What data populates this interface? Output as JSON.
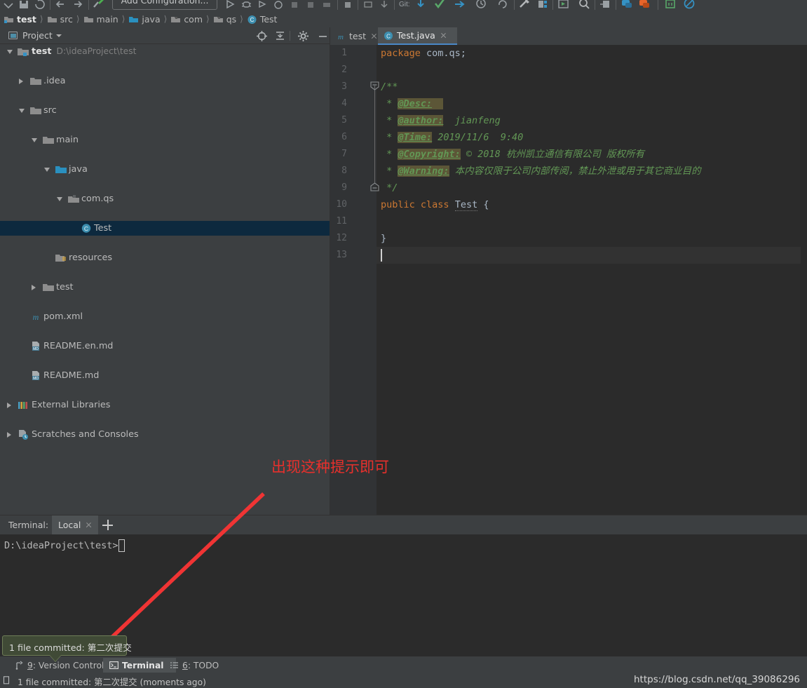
{
  "window": {
    "run_configuration": "Add Configuration..."
  },
  "breadcrumb": [
    {
      "label": "test",
      "icon": "project-module-icon"
    },
    {
      "label": "src",
      "icon": "folder-icon"
    },
    {
      "label": "main",
      "icon": "folder-icon"
    },
    {
      "label": "java",
      "icon": "source-folder-icon"
    },
    {
      "label": "com",
      "icon": "package-icon"
    },
    {
      "label": "qs",
      "icon": "package-icon"
    },
    {
      "label": "Test",
      "icon": "java-class-icon"
    }
  ],
  "project_panel": {
    "title": "Project",
    "buttons": [
      {
        "name": "locate-target-icon",
        "label": "Select Opened File"
      },
      {
        "name": "collapse-all-icon",
        "label": "Collapse All"
      },
      {
        "name": "gear-icon",
        "label": "Settings"
      },
      {
        "name": "minimize-icon",
        "label": "Hide"
      }
    ],
    "tree": [
      {
        "label": "test",
        "path": "D:\\ideaProject\\test",
        "indent": 0,
        "arrow": "open",
        "icon": "module-icon",
        "bold": true,
        "selected": false
      },
      {
        "label": ".idea",
        "path": "",
        "indent": 1,
        "arrow": "closed",
        "icon": "folder-icon",
        "bold": false,
        "selected": false
      },
      {
        "label": "src",
        "path": "",
        "indent": 1,
        "arrow": "open",
        "icon": "folder-icon",
        "bold": false,
        "selected": false
      },
      {
        "label": "main",
        "path": "",
        "indent": 2,
        "arrow": "open",
        "icon": "folder-icon",
        "bold": false,
        "selected": false
      },
      {
        "label": "java",
        "path": "",
        "indent": 3,
        "arrow": "open",
        "icon": "source-folder-icon",
        "bold": false,
        "selected": false
      },
      {
        "label": "com.qs",
        "path": "",
        "indent": 4,
        "arrow": "open",
        "icon": "package-icon",
        "bold": false,
        "selected": false
      },
      {
        "label": "Test",
        "path": "",
        "indent": 5,
        "arrow": "none",
        "icon": "java-class-icon",
        "bold": false,
        "selected": true
      },
      {
        "label": "resources",
        "path": "",
        "indent": 4,
        "arrow": "none",
        "icon": "resources-folder-icon",
        "bold": false,
        "selected": false
      },
      {
        "label": "test",
        "path": "",
        "indent": 2,
        "arrow": "closed",
        "icon": "folder-icon",
        "bold": false,
        "selected": false
      },
      {
        "label": "pom.xml",
        "path": "",
        "indent": 2,
        "arrow": "none",
        "icon": "maven-icon",
        "bold": false,
        "selected": false
      },
      {
        "label": "README.en.md",
        "path": "",
        "indent": 2,
        "arrow": "none",
        "icon": "markdown-icon",
        "bold": false,
        "selected": false
      },
      {
        "label": "README.md",
        "path": "",
        "indent": 2,
        "arrow": "none",
        "icon": "markdown-icon",
        "bold": false,
        "selected": false
      },
      {
        "label": "External Libraries",
        "path": "",
        "indent": 0,
        "arrow": "closed",
        "icon": "libraries-icon",
        "bold": false,
        "selected": false
      },
      {
        "label": "Scratches and Consoles",
        "path": "",
        "indent": 0,
        "arrow": "closed",
        "icon": "scratches-icon",
        "bold": false,
        "selected": false
      }
    ]
  },
  "editor": {
    "tabs": [
      {
        "label": "test",
        "icon": "maven-icon",
        "active": false
      },
      {
        "label": "Test.java",
        "icon": "java-class-icon",
        "active": true
      }
    ],
    "line_numbers": [
      "1",
      "2",
      "3",
      "4",
      "5",
      "6",
      "7",
      "8",
      "9",
      "10",
      "11",
      "12",
      "13"
    ],
    "code_lines": [
      {
        "n": 1,
        "segments": [
          {
            "t": "package",
            "c": "kw"
          },
          {
            "t": " com.qs;",
            "c": "pl"
          }
        ]
      },
      {
        "n": 2,
        "segments": []
      },
      {
        "n": 3,
        "segments": [
          {
            "t": "/**",
            "c": "cm"
          }
        ]
      },
      {
        "n": 4,
        "segments": [
          {
            "t": " * ",
            "c": "cm"
          },
          {
            "t": "@Desc:",
            "c": "tag"
          }
        ]
      },
      {
        "n": 5,
        "segments": [
          {
            "t": " * ",
            "c": "cm"
          },
          {
            "t": "@author:",
            "c": "tag"
          },
          {
            "t": "  jianfeng",
            "c": "cmz"
          }
        ]
      },
      {
        "n": 6,
        "segments": [
          {
            "t": " * ",
            "c": "cm"
          },
          {
            "t": "@Time:",
            "c": "tag"
          },
          {
            "t": " 2019/11/6  9:40",
            "c": "cmz"
          }
        ]
      },
      {
        "n": 7,
        "segments": [
          {
            "t": " * ",
            "c": "cm"
          },
          {
            "t": "@Copyright:",
            "c": "tag"
          },
          {
            "t": " © 2018 杭州凯立通信有限公司 版权所有",
            "c": "cmz"
          }
        ]
      },
      {
        "n": 8,
        "segments": [
          {
            "t": " * ",
            "c": "cm"
          },
          {
            "t": "@Warning:",
            "c": "tag"
          },
          {
            "t": " 本内容仅限于公司内部传阅，禁止外泄或用于其它商业目的",
            "c": "cmz"
          }
        ]
      },
      {
        "n": 9,
        "segments": [
          {
            "t": " */",
            "c": "cm"
          }
        ]
      },
      {
        "n": 10,
        "segments": [
          {
            "t": "public",
            "c": "kw"
          },
          {
            "t": " ",
            "c": "pl"
          },
          {
            "t": "class",
            "c": "kw"
          },
          {
            "t": " ",
            "c": "pl"
          },
          {
            "t": "Test",
            "c": "cname"
          },
          {
            "t": " {",
            "c": "pl"
          }
        ]
      },
      {
        "n": 11,
        "segments": []
      },
      {
        "n": 12,
        "segments": [
          {
            "t": "}",
            "c": "pl"
          }
        ]
      },
      {
        "n": 13,
        "segments": []
      }
    ]
  },
  "terminal": {
    "label": "Terminal:",
    "tab": "Local",
    "add_tab": "+",
    "prompt": "D:\\ideaProject\\test>"
  },
  "tool_windows": [
    {
      "label_num": "9",
      "label": ": Version Control",
      "icon": "version-control-icon",
      "active": false
    },
    {
      "label_num": "",
      "label": "Terminal",
      "icon": "terminal-icon",
      "active": true
    },
    {
      "label_num": "6",
      "label": ": TODO",
      "icon": "todo-icon",
      "active": false
    }
  ],
  "status_bar": {
    "message": "1 file committed: 第二次提交 (moments ago)",
    "icon": "event-log-icon"
  },
  "notification_balloon": {
    "text": "1 file committed: 第二次提交"
  },
  "annotations": {
    "red_note": "出现这种提示即可",
    "arrow_color": "#f03434"
  },
  "watermark": {
    "text": "https://blog.csdn.net/qq_39086296"
  },
  "colors": {
    "panel_bg": "#3c3f41",
    "editor_bg": "#2b2b2b",
    "gutter_bg": "#313335",
    "selection": "#0d293e",
    "accent": "#4a88c7",
    "keyword": "#cc7832",
    "comment": "#629755",
    "tag_highlight": "#5c5637",
    "red": "#e8302c",
    "balloon_bg": "#404a36",
    "balloon_border": "#6f7d58"
  }
}
